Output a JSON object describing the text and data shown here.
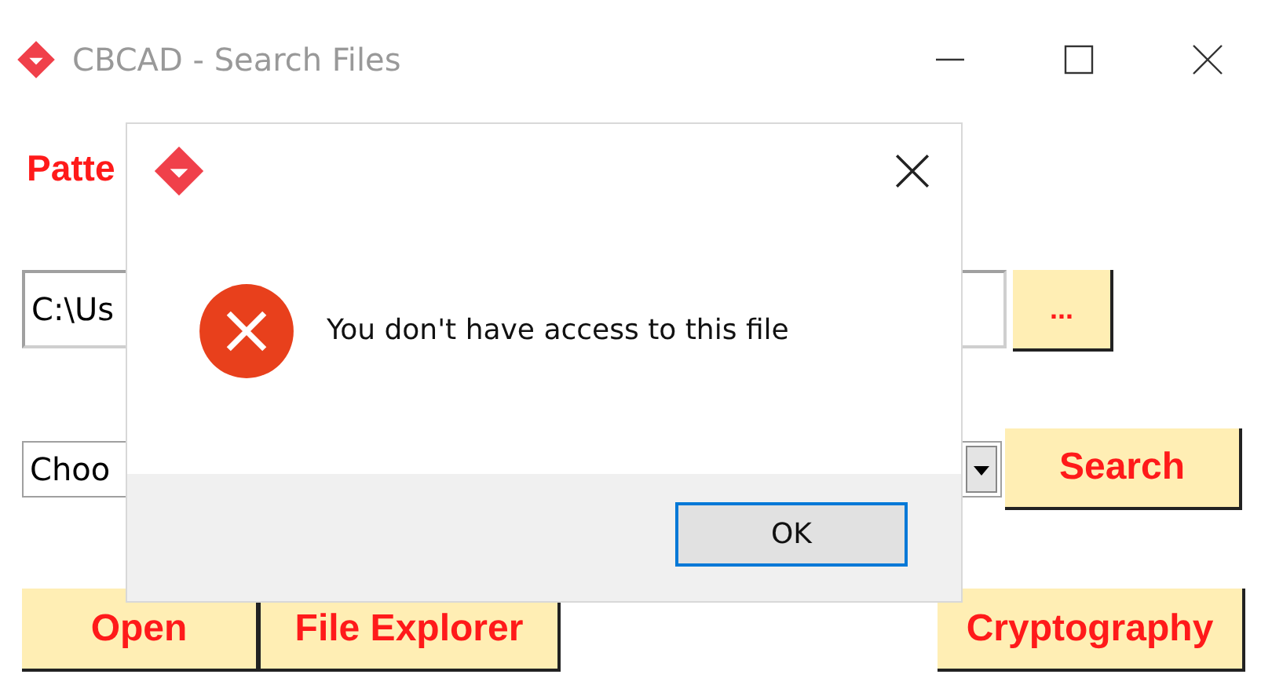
{
  "window": {
    "title": "CBCAD - Search Files"
  },
  "label": "Patte",
  "path_field": {
    "value": "C:\\Us"
  },
  "browse_button": "...",
  "filter_combo": {
    "value": "Choo"
  },
  "search_button": "Search",
  "bottom_buttons": [
    {
      "label": "Open"
    },
    {
      "label": "File Explorer"
    },
    {
      "label": "Cryptography"
    }
  ],
  "dialog": {
    "message": "You don't have access to this file",
    "buttons": [
      {
        "label": "OK",
        "selected": true
      }
    ]
  }
}
